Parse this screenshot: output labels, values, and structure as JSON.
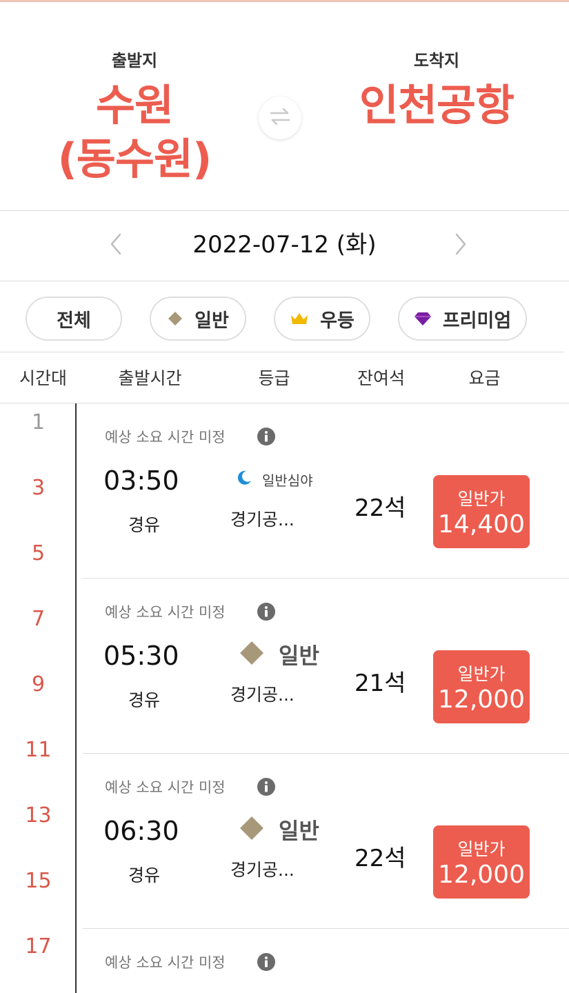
{
  "route": {
    "departure_label": "출발지",
    "departure_name": "수원\n(동수원)",
    "arrival_label": "도착지",
    "arrival_name": "인천공항"
  },
  "date": {
    "text": "2022-07-12 (화)"
  },
  "filters": [
    {
      "label": "전체",
      "icon": null
    },
    {
      "label": "일반",
      "icon": "diamond-icon"
    },
    {
      "label": "우등",
      "icon": "crown-icon"
    },
    {
      "label": "프리미엄",
      "icon": "gem-icon"
    }
  ],
  "table_headers": [
    "시간대",
    "출발시간",
    "등급",
    "잔여석",
    "요금"
  ],
  "time_slots": [
    "1",
    "3",
    "5",
    "7",
    "9",
    "11",
    "13",
    "15",
    "17"
  ],
  "schedules": [
    {
      "eta": "예상 소요 시간 미정",
      "time": "03:50",
      "via": "경유",
      "grade": "일반심야",
      "grade_icon": "moon-icon",
      "company": "경기공...",
      "seats": "22석",
      "fare_type": "일반가",
      "fare": "14,400"
    },
    {
      "eta": "예상 소요 시간 미정",
      "time": "05:30",
      "via": "경유",
      "grade": "일반",
      "grade_icon": "diamond-icon",
      "company": "경기공...",
      "seats": "21석",
      "fare_type": "일반가",
      "fare": "12,000"
    },
    {
      "eta": "예상 소요 시간 미정",
      "time": "06:30",
      "via": "경유",
      "grade": "일반",
      "grade_icon": "diamond-icon",
      "company": "경기공...",
      "seats": "22석",
      "fare_type": "일반가",
      "fare": "12,000"
    },
    {
      "eta": "예상 소요 시간 미정"
    }
  ],
  "colors": {
    "accent": "#ec5d4f",
    "diamond": "#a8987a",
    "crown": "#f3b800",
    "gem": "#7a1fa2",
    "moon": "#1e8fd6"
  }
}
